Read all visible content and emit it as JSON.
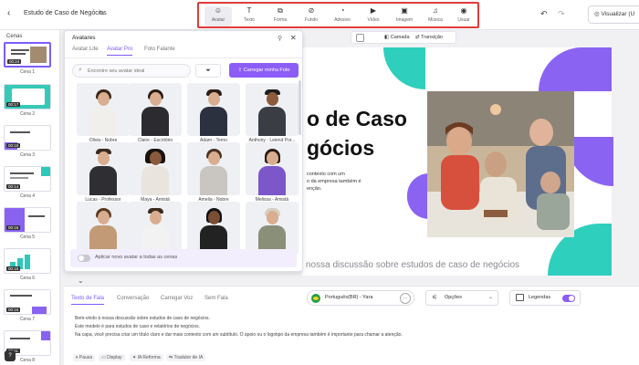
{
  "header": {
    "back_icon": "chevron-left-icon",
    "doc_title": "Estudo de Caso de Negócios",
    "edit_icon": "pencil-icon",
    "preview_label": "Visualizar (U"
  },
  "toolbar": {
    "items": [
      {
        "label": "Avatar",
        "icon": "avatar-icon",
        "active": true
      },
      {
        "label": "Texto",
        "icon": "text-icon"
      },
      {
        "label": "Forma",
        "icon": "shape-icon"
      },
      {
        "label": "Fundo",
        "icon": "background-icon"
      },
      {
        "label": "Adesivo",
        "icon": "sticker-icon"
      },
      {
        "label": "Vídeo",
        "icon": "video-icon"
      },
      {
        "label": "Imagem",
        "icon": "image-icon"
      },
      {
        "label": "Música",
        "icon": "music-icon"
      },
      {
        "label": "Usuar",
        "icon": "user-icon"
      }
    ],
    "highlight_color": "#e03b3b"
  },
  "scenes": {
    "label": "Cenas",
    "items": [
      {
        "caption": "Cena 1",
        "duration": "00:24",
        "active": true
      },
      {
        "caption": "Cena 2",
        "duration": "00:17"
      },
      {
        "caption": "Cena 3",
        "duration": "00:16"
      },
      {
        "caption": "Cena 4",
        "duration": "00:14"
      },
      {
        "caption": "Cena 5",
        "duration": "00:16"
      },
      {
        "caption": "Cena 6",
        "duration": "00:15"
      },
      {
        "caption": "Cena 7",
        "duration": "00:16"
      },
      {
        "caption": "Cena 8",
        "duration": "00:11"
      }
    ]
  },
  "avatar_panel": {
    "title": "Avatares",
    "tabs": [
      "Avatar Lite",
      "Avatar Pro",
      "Foto Falante"
    ],
    "active_tab": "Avatar Pro",
    "search_placeholder": "Encontre seu avatar ideal",
    "upload_label": "Carregar minha Foto",
    "apply_all_label": "Aplicar novo avatar a todas as cenas",
    "avatars": [
      {
        "name": "Olivia - Nobre"
      },
      {
        "name": "Claire - Escritório"
      },
      {
        "name": "Adam - Terno"
      },
      {
        "name": "Anthony - Leiend Por..."
      },
      {
        "name": "Lucas - Professor"
      },
      {
        "name": "Maya - Amistá"
      },
      {
        "name": "Amelia - Nobre"
      },
      {
        "name": "Melissa - Amistá"
      },
      {
        "name": ""
      },
      {
        "name": ""
      },
      {
        "name": ""
      },
      {
        "name": ""
      }
    ]
  },
  "canvas": {
    "toolbar": {
      "layer": "Camada",
      "transition": "Transição"
    },
    "slide_title_lines": [
      "o de Caso",
      "gócios"
    ],
    "slide_body_lines": [
      "contexto com um",
      "o da empresa também é",
      "enção."
    ],
    "subtitle": "nossa discussão sobre estudos de caso de negócios",
    "accent_teal": "#2fcfbd",
    "accent_purple": "#8b63f2"
  },
  "script": {
    "tabs": [
      "Texto de Fala",
      "Conversação",
      "Carregar Voz",
      "Sem Fala"
    ],
    "active_tab": "Texto de Fala",
    "voice": "Português(BR) - Yara",
    "options_label": "Opções",
    "captions_label": "Legendas",
    "lines": [
      "Bem-vindo à nossa discussão sobre estudos de caso de negócios.",
      "Este modelo é para estudos de caso e relatórios de negócios.",
      "Na capa, você precisa criar um título claro e dar mais contexto com um subtítulo. O apoio ou o logotipo da empresa também é importante para chamar a atenção."
    ],
    "actions": [
      "Pausa",
      "Display",
      "IA Reforma",
      "Tradutor de IA"
    ],
    "help_label": "?"
  }
}
